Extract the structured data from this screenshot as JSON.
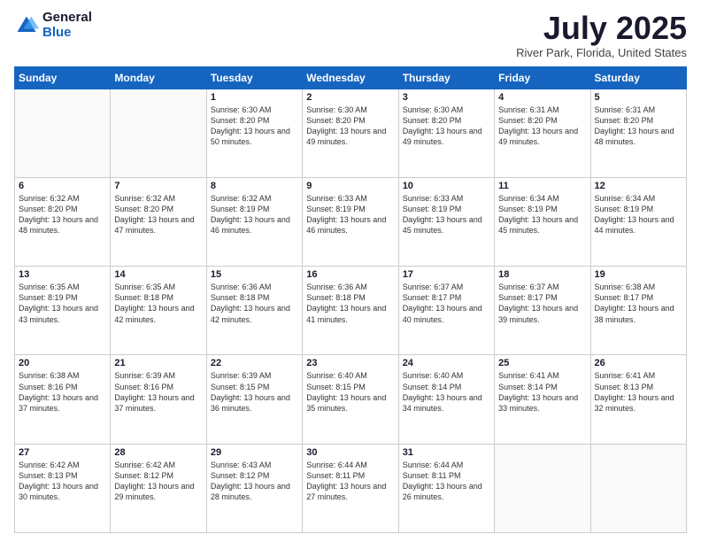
{
  "logo": {
    "general": "General",
    "blue": "Blue"
  },
  "header": {
    "month": "July 2025",
    "location": "River Park, Florida, United States"
  },
  "weekdays": [
    "Sunday",
    "Monday",
    "Tuesday",
    "Wednesday",
    "Thursday",
    "Friday",
    "Saturday"
  ],
  "weeks": [
    [
      {
        "day": "",
        "info": ""
      },
      {
        "day": "",
        "info": ""
      },
      {
        "day": "1",
        "info": "Sunrise: 6:30 AM\nSunset: 8:20 PM\nDaylight: 13 hours and 50 minutes."
      },
      {
        "day": "2",
        "info": "Sunrise: 6:30 AM\nSunset: 8:20 PM\nDaylight: 13 hours and 49 minutes."
      },
      {
        "day": "3",
        "info": "Sunrise: 6:30 AM\nSunset: 8:20 PM\nDaylight: 13 hours and 49 minutes."
      },
      {
        "day": "4",
        "info": "Sunrise: 6:31 AM\nSunset: 8:20 PM\nDaylight: 13 hours and 49 minutes."
      },
      {
        "day": "5",
        "info": "Sunrise: 6:31 AM\nSunset: 8:20 PM\nDaylight: 13 hours and 48 minutes."
      }
    ],
    [
      {
        "day": "6",
        "info": "Sunrise: 6:32 AM\nSunset: 8:20 PM\nDaylight: 13 hours and 48 minutes."
      },
      {
        "day": "7",
        "info": "Sunrise: 6:32 AM\nSunset: 8:20 PM\nDaylight: 13 hours and 47 minutes."
      },
      {
        "day": "8",
        "info": "Sunrise: 6:32 AM\nSunset: 8:19 PM\nDaylight: 13 hours and 46 minutes."
      },
      {
        "day": "9",
        "info": "Sunrise: 6:33 AM\nSunset: 8:19 PM\nDaylight: 13 hours and 46 minutes."
      },
      {
        "day": "10",
        "info": "Sunrise: 6:33 AM\nSunset: 8:19 PM\nDaylight: 13 hours and 45 minutes."
      },
      {
        "day": "11",
        "info": "Sunrise: 6:34 AM\nSunset: 8:19 PM\nDaylight: 13 hours and 45 minutes."
      },
      {
        "day": "12",
        "info": "Sunrise: 6:34 AM\nSunset: 8:19 PM\nDaylight: 13 hours and 44 minutes."
      }
    ],
    [
      {
        "day": "13",
        "info": "Sunrise: 6:35 AM\nSunset: 8:19 PM\nDaylight: 13 hours and 43 minutes."
      },
      {
        "day": "14",
        "info": "Sunrise: 6:35 AM\nSunset: 8:18 PM\nDaylight: 13 hours and 42 minutes."
      },
      {
        "day": "15",
        "info": "Sunrise: 6:36 AM\nSunset: 8:18 PM\nDaylight: 13 hours and 42 minutes."
      },
      {
        "day": "16",
        "info": "Sunrise: 6:36 AM\nSunset: 8:18 PM\nDaylight: 13 hours and 41 minutes."
      },
      {
        "day": "17",
        "info": "Sunrise: 6:37 AM\nSunset: 8:17 PM\nDaylight: 13 hours and 40 minutes."
      },
      {
        "day": "18",
        "info": "Sunrise: 6:37 AM\nSunset: 8:17 PM\nDaylight: 13 hours and 39 minutes."
      },
      {
        "day": "19",
        "info": "Sunrise: 6:38 AM\nSunset: 8:17 PM\nDaylight: 13 hours and 38 minutes."
      }
    ],
    [
      {
        "day": "20",
        "info": "Sunrise: 6:38 AM\nSunset: 8:16 PM\nDaylight: 13 hours and 37 minutes."
      },
      {
        "day": "21",
        "info": "Sunrise: 6:39 AM\nSunset: 8:16 PM\nDaylight: 13 hours and 37 minutes."
      },
      {
        "day": "22",
        "info": "Sunrise: 6:39 AM\nSunset: 8:15 PM\nDaylight: 13 hours and 36 minutes."
      },
      {
        "day": "23",
        "info": "Sunrise: 6:40 AM\nSunset: 8:15 PM\nDaylight: 13 hours and 35 minutes."
      },
      {
        "day": "24",
        "info": "Sunrise: 6:40 AM\nSunset: 8:14 PM\nDaylight: 13 hours and 34 minutes."
      },
      {
        "day": "25",
        "info": "Sunrise: 6:41 AM\nSunset: 8:14 PM\nDaylight: 13 hours and 33 minutes."
      },
      {
        "day": "26",
        "info": "Sunrise: 6:41 AM\nSunset: 8:13 PM\nDaylight: 13 hours and 32 minutes."
      }
    ],
    [
      {
        "day": "27",
        "info": "Sunrise: 6:42 AM\nSunset: 8:13 PM\nDaylight: 13 hours and 30 minutes."
      },
      {
        "day": "28",
        "info": "Sunrise: 6:42 AM\nSunset: 8:12 PM\nDaylight: 13 hours and 29 minutes."
      },
      {
        "day": "29",
        "info": "Sunrise: 6:43 AM\nSunset: 8:12 PM\nDaylight: 13 hours and 28 minutes."
      },
      {
        "day": "30",
        "info": "Sunrise: 6:44 AM\nSunset: 8:11 PM\nDaylight: 13 hours and 27 minutes."
      },
      {
        "day": "31",
        "info": "Sunrise: 6:44 AM\nSunset: 8:11 PM\nDaylight: 13 hours and 26 minutes."
      },
      {
        "day": "",
        "info": ""
      },
      {
        "day": "",
        "info": ""
      }
    ]
  ]
}
